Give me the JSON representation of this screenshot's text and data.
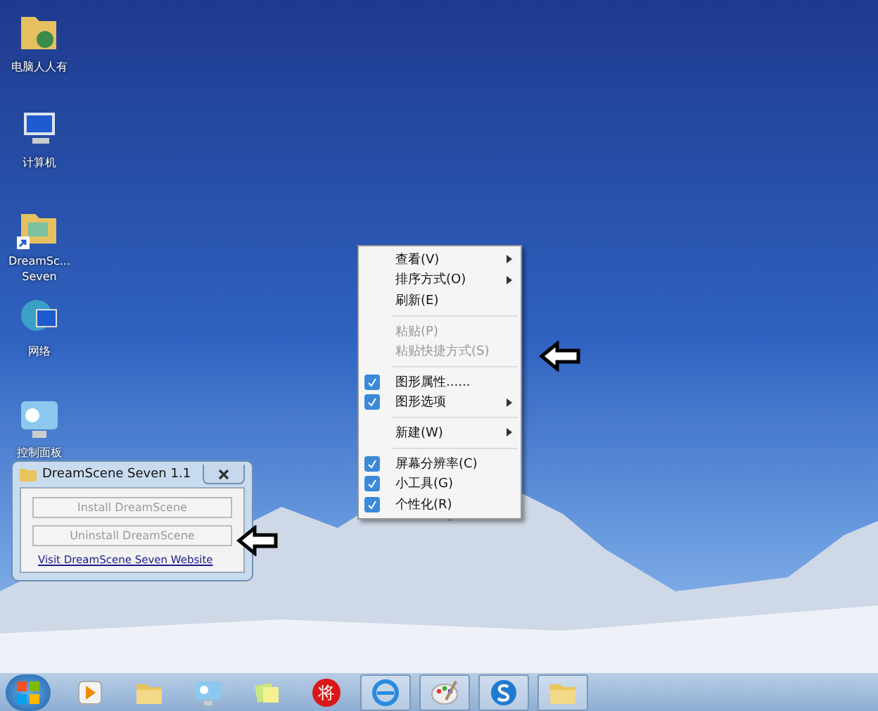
{
  "desktop_icons": [
    {
      "label": "电脑人人有",
      "shortcut": false
    },
    {
      "label": "计算机",
      "shortcut": false
    },
    {
      "label": "DreamSc... Seven",
      "shortcut": true
    },
    {
      "label": "网络",
      "shortcut": false
    },
    {
      "label": "控制面板",
      "shortcut": false
    }
  ],
  "context_menu": {
    "items": [
      {
        "kind": "item",
        "label": "查看(V)",
        "submenu": true,
        "disabled": false,
        "icon": false
      },
      {
        "kind": "item",
        "label": "排序方式(O)",
        "submenu": true,
        "disabled": false,
        "icon": false
      },
      {
        "kind": "item",
        "label": "刷新(E)",
        "submenu": false,
        "disabled": false,
        "icon": false
      },
      {
        "kind": "separator"
      },
      {
        "kind": "item",
        "label": "粘贴(P)",
        "submenu": false,
        "disabled": true,
        "icon": false
      },
      {
        "kind": "item",
        "label": "粘贴快捷方式(S)",
        "submenu": false,
        "disabled": true,
        "icon": false
      },
      {
        "kind": "separator"
      },
      {
        "kind": "item",
        "label": "图形属性......",
        "submenu": false,
        "disabled": false,
        "icon": true
      },
      {
        "kind": "item",
        "label": "图形选项",
        "submenu": true,
        "disabled": false,
        "icon": true
      },
      {
        "kind": "separator"
      },
      {
        "kind": "item",
        "label": "新建(W)",
        "submenu": true,
        "disabled": false,
        "icon": false
      },
      {
        "kind": "separator"
      },
      {
        "kind": "item",
        "label": "屏幕分辨率(C)",
        "submenu": false,
        "disabled": false,
        "icon": true
      },
      {
        "kind": "item",
        "label": "小工具(G)",
        "submenu": false,
        "disabled": false,
        "icon": true
      },
      {
        "kind": "item",
        "label": "个性化(R)",
        "submenu": false,
        "disabled": false,
        "icon": true
      }
    ]
  },
  "dialog": {
    "title": "DreamScene Seven 1.1",
    "buttons": [
      {
        "label": "Install DreamScene",
        "disabled": true
      },
      {
        "label": "Uninstall DreamScene",
        "disabled": true
      }
    ],
    "link": "Visit DreamScene Seven Website"
  },
  "taskbar": {
    "items": [
      {
        "kind": "media",
        "running": false
      },
      {
        "kind": "folder",
        "running": false
      },
      {
        "kind": "panel",
        "running": false
      },
      {
        "kind": "notes",
        "running": false
      },
      {
        "kind": "badge",
        "text": "将",
        "running": false
      },
      {
        "kind": "browser",
        "running": true
      },
      {
        "kind": "paint",
        "running": true
      },
      {
        "kind": "s",
        "running": true
      },
      {
        "kind": "folder",
        "running": true
      }
    ]
  }
}
